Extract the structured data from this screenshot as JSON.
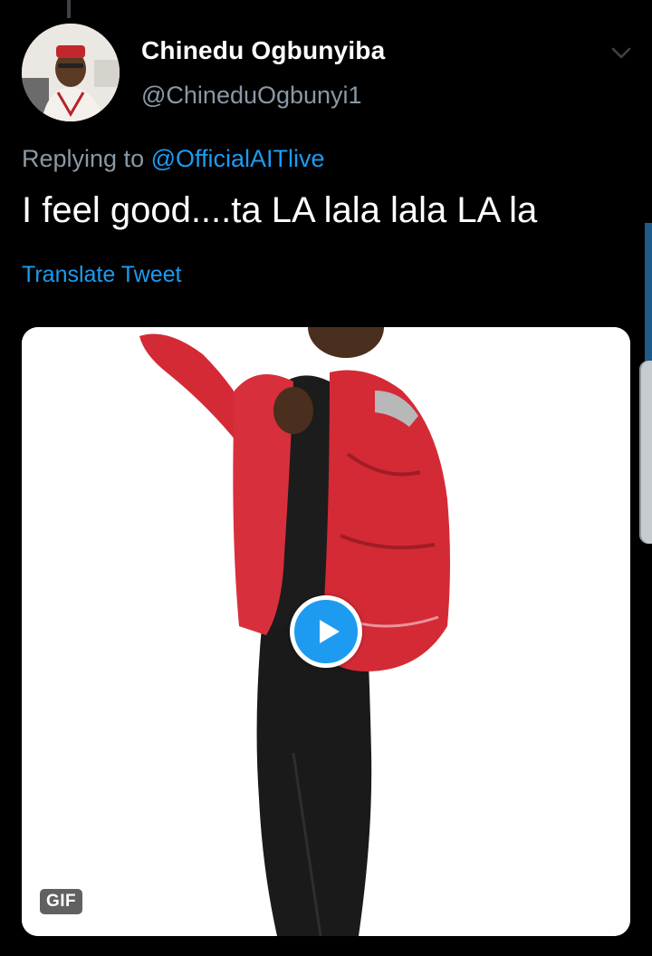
{
  "tweet": {
    "display_name": "Chinedu Ogbunyiba",
    "handle": "@ChineduOgbunyi1",
    "replying_prefix": "Replying to",
    "replying_to": "@OfficialAITlive",
    "text": "I feel good....ta LA lala lala LA la",
    "translate_label": "Translate Tweet"
  },
  "media": {
    "badge": "GIF",
    "play_icon": "play-icon"
  },
  "icons": {
    "more": "chevron-down-icon",
    "avatar": "profile-photo"
  },
  "colors": {
    "background": "#000000",
    "accent": "#1d9bf0",
    "secondary_text": "#8b98a5",
    "primary_text": "#ffffff"
  }
}
